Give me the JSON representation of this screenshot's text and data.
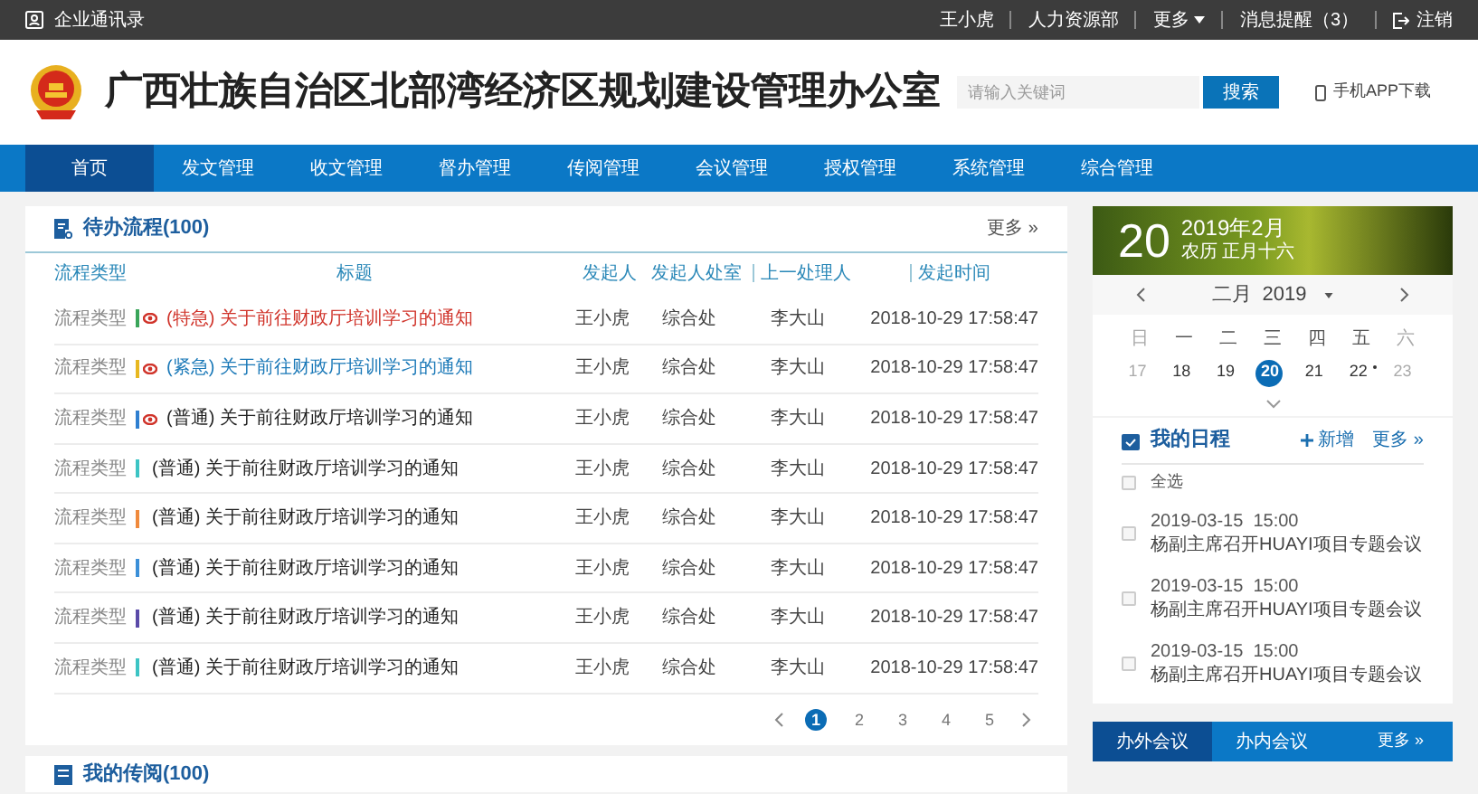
{
  "top_bar": {
    "left_link": "企业通讯录",
    "user": "王小虎",
    "department": "人力资源部",
    "more": "更多",
    "messages": "消息提醒（3）",
    "logout": "注销"
  },
  "header": {
    "title": "广西壮族自治区北部湾经济区规划建设管理办公室",
    "search": {
      "placeholder": "请输入关键词"
    },
    "search_button": "搜索",
    "app_download": "手机APP下载"
  },
  "nav": [
    {
      "label": "首页",
      "selected": true
    },
    {
      "label": "发文管理",
      "selected": false
    },
    {
      "label": "收文管理",
      "selected": false
    },
    {
      "label": "督办管理",
      "selected": false
    },
    {
      "label": "传阅管理",
      "selected": false
    },
    {
      "label": "会议管理",
      "selected": false
    },
    {
      "label": "授权管理",
      "selected": false
    },
    {
      "label": "系统管理",
      "selected": false
    },
    {
      "label": "综合管理",
      "selected": false
    }
  ],
  "todo": {
    "title": "待办流程(100)",
    "more": "更多 »",
    "columns": [
      "流程类型",
      "标题",
      "发起人",
      "发起人处室",
      "上一处理人",
      "发起时间"
    ],
    "rows": [
      {
        "type": "流程类型",
        "color": "#3aa55a",
        "flagged": true,
        "kind": "special",
        "title": "(特急) 关于前往财政厅培训学习的通知",
        "initiator": "王小虎",
        "office": "综合处",
        "previous": "李大山",
        "time": "2018-10-29 17:58:47"
      },
      {
        "type": "流程类型",
        "color": "#e8b820",
        "flagged": true,
        "kind": "urgent",
        "title": "(紧急) 关于前往财政厅培训学习的通知",
        "initiator": "王小虎",
        "office": "综合处",
        "previous": "李大山",
        "time": "2018-10-29 17:58:47"
      },
      {
        "type": "流程类型",
        "color": "#2f7fd0",
        "flagged": true,
        "kind": "normal",
        "title": "(普通) 关于前往财政厅培训学习的通知",
        "initiator": "王小虎",
        "office": "综合处",
        "previous": "李大山",
        "time": "2018-10-29 17:58:47"
      },
      {
        "type": "流程类型",
        "color": "#3cc4c4",
        "flagged": false,
        "kind": "normal",
        "title": "(普通) 关于前往财政厅培训学习的通知",
        "initiator": "王小虎",
        "office": "综合处",
        "previous": "李大山",
        "time": "2018-10-29 17:58:47"
      },
      {
        "type": "流程类型",
        "color": "#f08a3c",
        "flagged": false,
        "kind": "normal",
        "title": "(普通) 关于前往财政厅培训学习的通知",
        "initiator": "王小虎",
        "office": "综合处",
        "previous": "李大山",
        "time": "2018-10-29 17:58:47"
      },
      {
        "type": "流程类型",
        "color": "#3b8fd8",
        "flagged": false,
        "kind": "normal",
        "title": "(普通) 关于前往财政厅培训学习的通知",
        "initiator": "王小虎",
        "office": "综合处",
        "previous": "李大山",
        "time": "2018-10-29 17:58:47"
      },
      {
        "type": "流程类型",
        "color": "#5a4aa8",
        "flagged": false,
        "kind": "normal",
        "title": "(普通) 关于前往财政厅培训学习的通知",
        "initiator": "王小虎",
        "office": "综合处",
        "previous": "李大山",
        "time": "2018-10-29 17:58:47"
      },
      {
        "type": "流程类型",
        "color": "#3cc4c4",
        "flagged": false,
        "kind": "normal",
        "title": "(普通) 关于前往财政厅培训学习的通知",
        "initiator": "王小虎",
        "office": "综合处",
        "previous": "李大山",
        "time": "2018-10-29 17:58:47"
      }
    ],
    "pagination": [
      {
        "label": "1",
        "selected": true
      },
      {
        "label": "2",
        "selected": false
      },
      {
        "label": "3",
        "selected": false
      },
      {
        "label": "4",
        "selected": false
      },
      {
        "label": "5",
        "selected": false
      }
    ]
  },
  "second_card": {
    "title": "我的传阅(100)"
  },
  "calendar": {
    "day": "20",
    "year_month": "2019年2月",
    "lunar": "农历 正月十六",
    "month_label": "二月",
    "year": "2019",
    "weekdays": [
      {
        "label": "日",
        "weekend": true
      },
      {
        "label": "一",
        "weekend": false
      },
      {
        "label": "二",
        "weekend": false
      },
      {
        "label": "三",
        "weekend": false
      },
      {
        "label": "四",
        "weekend": false
      },
      {
        "label": "五",
        "weekend": false
      },
      {
        "label": "六",
        "weekend": true
      }
    ],
    "days": [
      {
        "label": "17",
        "selected": false,
        "has_event": false
      },
      {
        "label": "18",
        "selected": false,
        "has_event": false
      },
      {
        "label": "19",
        "selected": false,
        "has_event": false
      },
      {
        "label": "20",
        "selected": true,
        "has_event": false
      },
      {
        "label": "21",
        "selected": false,
        "has_event": false
      },
      {
        "label": "22",
        "selected": false,
        "has_event": true
      },
      {
        "label": "23",
        "selected": false,
        "has_event": false
      }
    ]
  },
  "schedule": {
    "title": "我的日程",
    "add": "新增",
    "more": "更多 »",
    "select_all": {
      "label": "全选",
      "checked": false
    },
    "items": [
      {
        "time": "2019-03-15  15:00",
        "text": "杨副主席召开HUAYI项目专题会议",
        "checked": false
      },
      {
        "time": "2019-03-15  15:00",
        "text": "杨副主席召开HUAYI项目专题会议",
        "checked": false
      },
      {
        "time": "2019-03-15  15:00",
        "text": "杨副主席召开HUAYI项目专题会议",
        "checked": false
      }
    ]
  },
  "meeting_tabs": {
    "tabs": [
      {
        "label": "办外会议",
        "selected": true
      },
      {
        "label": "办内会议",
        "selected": false
      }
    ],
    "more": "更多 »"
  }
}
